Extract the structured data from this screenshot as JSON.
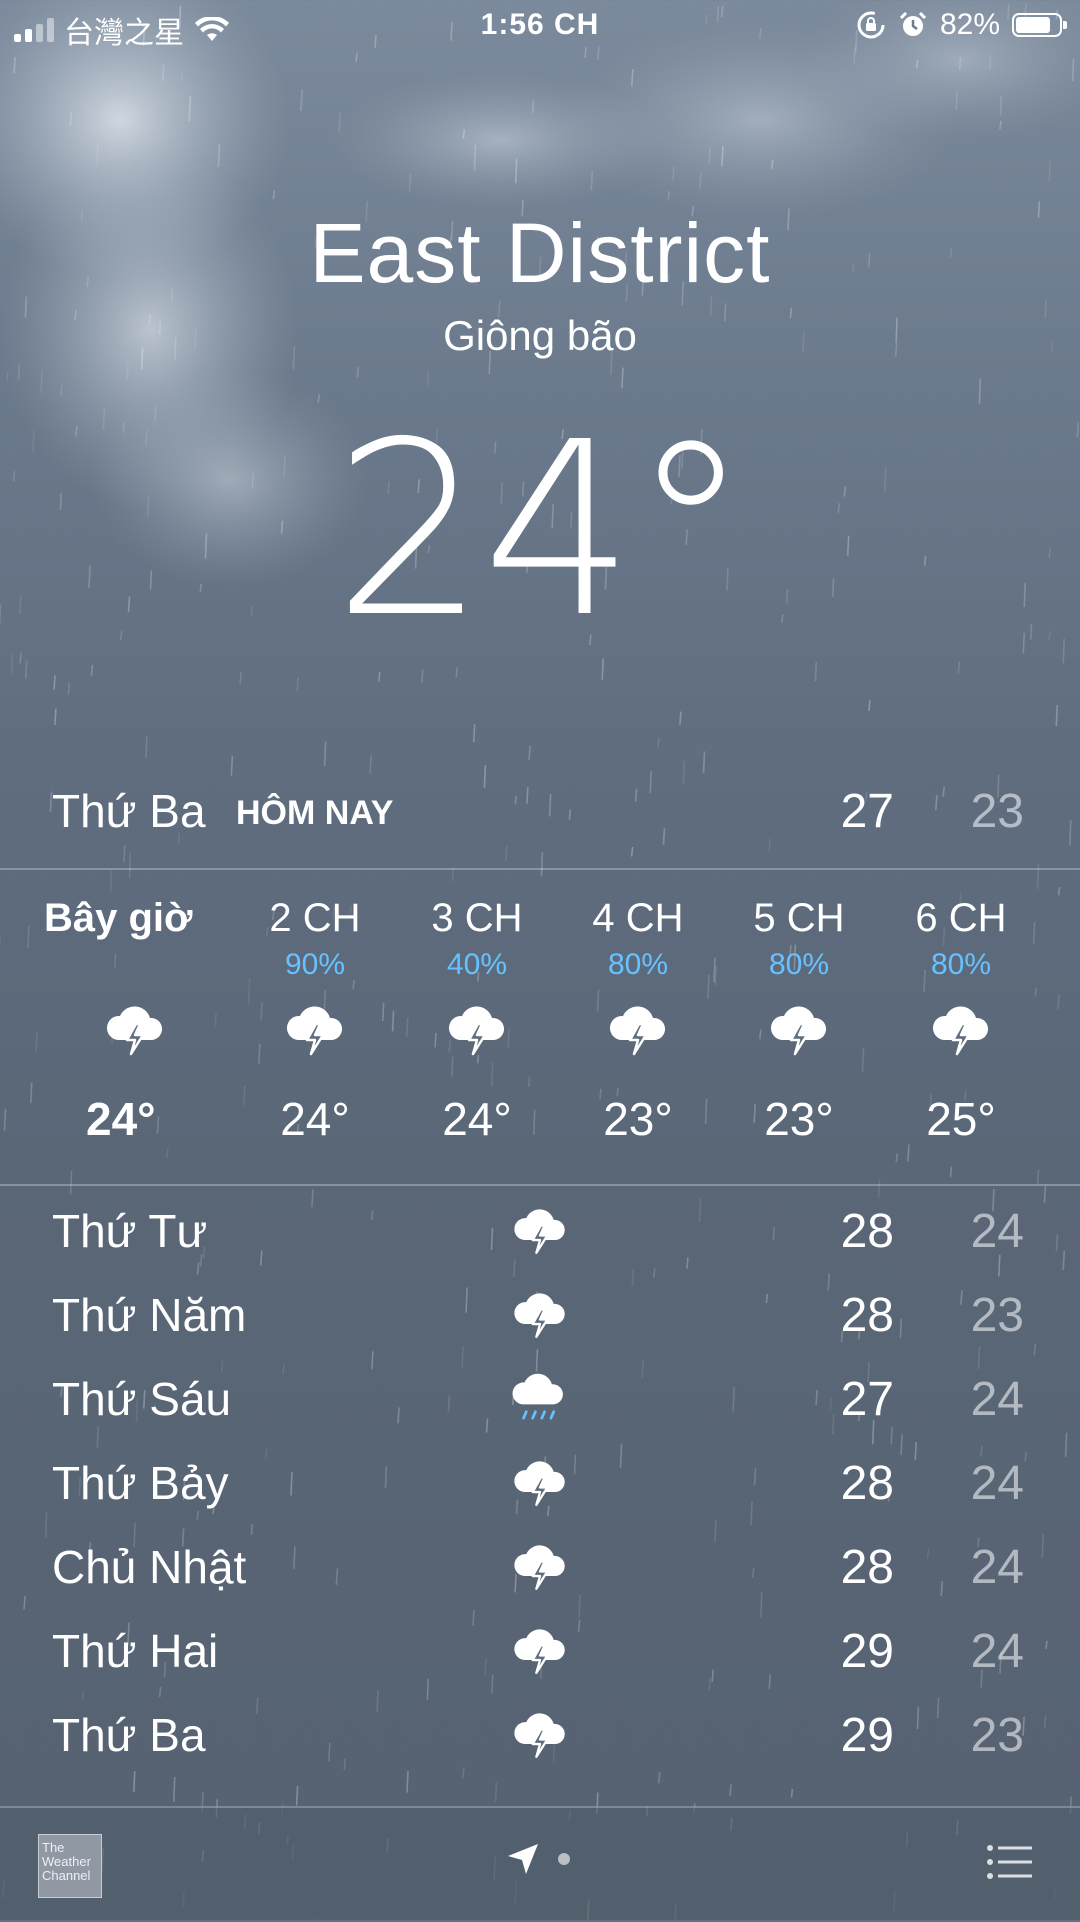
{
  "status_bar": {
    "carrier": "台灣之星",
    "time": "1:56 CH",
    "battery": "82%",
    "battery_level": 0.82
  },
  "location": {
    "city": "East District",
    "condition": "Giông bão",
    "temperature": "24°"
  },
  "today": {
    "day": "Thứ Ba",
    "tag": "HÔM NAY",
    "high": "27",
    "low": "23"
  },
  "hourly": [
    {
      "label": "Bây giờ",
      "precip": "",
      "icon": "thunderstorm-icon",
      "temp": "24°"
    },
    {
      "label": "2 CH",
      "precip": "90%",
      "icon": "thunderstorm-icon",
      "temp": "24°"
    },
    {
      "label": "3 CH",
      "precip": "40%",
      "icon": "thunderstorm-icon",
      "temp": "24°"
    },
    {
      "label": "4 CH",
      "precip": "80%",
      "icon": "thunderstorm-icon",
      "temp": "23°"
    },
    {
      "label": "5 CH",
      "precip": "80%",
      "icon": "thunderstorm-icon",
      "temp": "23°"
    },
    {
      "label": "6 CH",
      "precip": "80%",
      "icon": "thunderstorm-icon",
      "temp": "25°"
    }
  ],
  "daily": [
    {
      "day": "Thứ Tư",
      "icon": "thunderstorm-icon",
      "high": "28",
      "low": "24"
    },
    {
      "day": "Thứ Năm",
      "icon": "thunderstorm-icon",
      "high": "28",
      "low": "23"
    },
    {
      "day": "Thứ Sáu",
      "icon": "rain-icon",
      "high": "27",
      "low": "24"
    },
    {
      "day": "Thứ Bảy",
      "icon": "thunderstorm-icon",
      "high": "28",
      "low": "24"
    },
    {
      "day": "Chủ Nhật",
      "icon": "thunderstorm-icon",
      "high": "28",
      "low": "24"
    },
    {
      "day": "Thứ Hai",
      "icon": "thunderstorm-icon",
      "high": "29",
      "low": "24"
    },
    {
      "day": "Thứ Ba",
      "icon": "thunderstorm-icon",
      "high": "29",
      "low": "23"
    }
  ],
  "bottom_bar": {
    "logo_text": "The Weather Channel",
    "location_icon": "location-arrow-icon",
    "list_icon": "list-icon"
  },
  "colors": {
    "precip": "#67c1ff",
    "low_temp": "rgba(255,255,255,0.55)",
    "background": "#5f6d7f"
  }
}
